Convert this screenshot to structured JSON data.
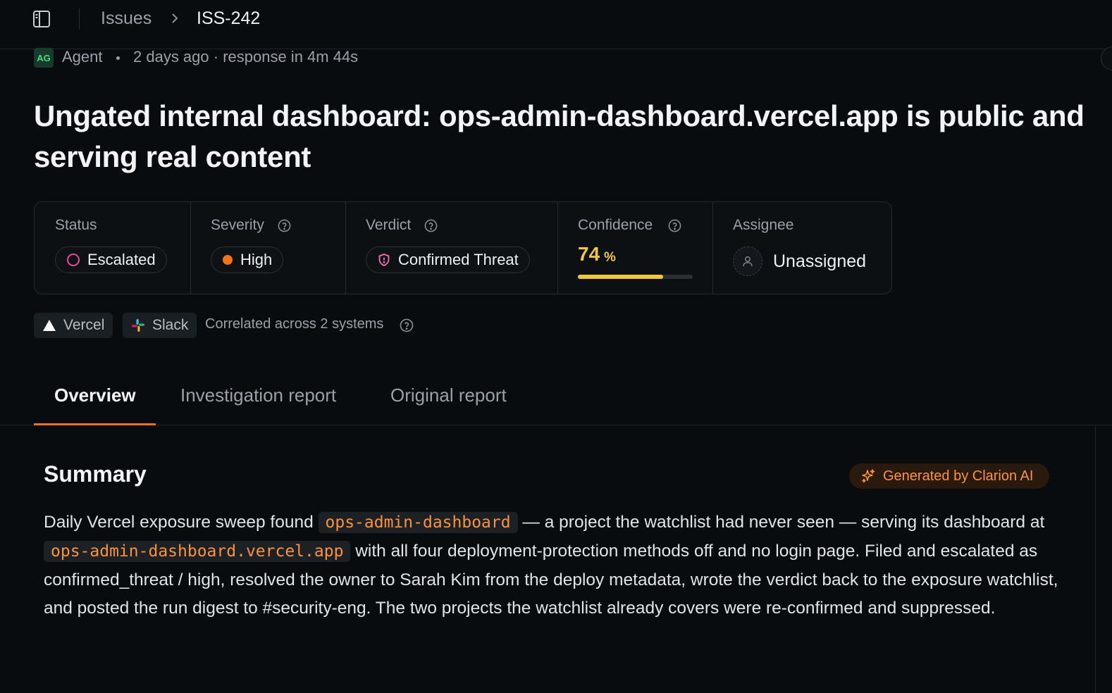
{
  "breadcrumb": {
    "parent": "Issues",
    "current": "ISS-242"
  },
  "meta": {
    "avatar_initials": "AG",
    "author": "Agent",
    "time_info": "2 days ago · response in 4m 44s"
  },
  "title": "Ungated internal dashboard: ops-admin-dashboard.vercel.app is public and serving real content",
  "properties": {
    "status": {
      "label": "Status",
      "value": "Escalated",
      "color": "#ec4899"
    },
    "severity": {
      "label": "Severity",
      "value": "High",
      "color": "#f97316"
    },
    "verdict": {
      "label": "Verdict",
      "value": "Confirmed Threat",
      "color": "#f472b6"
    },
    "confidence": {
      "label": "Confidence",
      "value": "74",
      "unit": "%",
      "fraction": 0.74,
      "color": "#f5c542"
    },
    "assignee": {
      "label": "Assignee",
      "value": "Unassigned"
    }
  },
  "sources": {
    "chips": [
      {
        "label": "Vercel",
        "icon": "vercel-triangle-icon"
      },
      {
        "label": "Slack",
        "icon": "slack-icon"
      }
    ],
    "correlated_text": "Correlated across 2 systems"
  },
  "tabs": [
    {
      "label": "Overview",
      "active": true
    },
    {
      "label": "Investigation report",
      "active": false
    },
    {
      "label": "Original report",
      "active": false
    }
  ],
  "summary": {
    "title": "Summary",
    "ai_badge": "Generated by Clarion AI",
    "text_1": "Daily Vercel exposure sweep found ",
    "code_1": "ops-admin-dashboard",
    "text_2": " — a project the watchlist had never seen — serving its dashboard at ",
    "code_2": "ops-admin-dashboard.vercel.app",
    "text_3": " with all four deployment-protection methods off and no login page. Filed and escalated as confirmed_threat / high, resolved the owner to Sarah Kim from the deploy metadata, wrote the verdict back to the exposure watchlist, and posted the run digest to #security-eng. The two projects the watchlist already covers were re-confirmed and suppressed."
  },
  "colors": {
    "accent": "#f97316",
    "background": "#090c0f",
    "code_text": "#fb923c"
  }
}
